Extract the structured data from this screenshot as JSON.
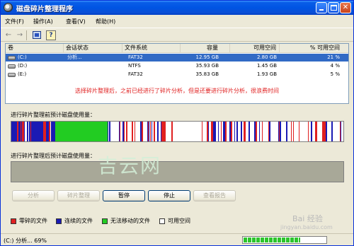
{
  "window": {
    "title": "磁盘碎片整理程序",
    "controls": {
      "minimize": "",
      "maximize": "",
      "close": "✕"
    }
  },
  "menu": [
    "文件(F)",
    "操作(A)",
    "查看(V)",
    "帮助(H)"
  ],
  "toolbar": {
    "back": "←",
    "forward": "→",
    "help": "?"
  },
  "volumes": {
    "headers": [
      "卷",
      "会话状态",
      "文件系统",
      "容量",
      "可用空间",
      "% 可用空间"
    ],
    "rows": [
      {
        "volume": "(C:)",
        "status": "分析...",
        "fs": "FAT32",
        "capacity": "12.95 GB",
        "free": "2.80 GB",
        "pct": "21 %",
        "selected": true
      },
      {
        "volume": "(D:)",
        "status": "",
        "fs": "NTFS",
        "capacity": "35.93 GB",
        "free": "1.45 GB",
        "pct": "4 %",
        "selected": false
      },
      {
        "volume": "(E:)",
        "status": "",
        "fs": "FAT32",
        "capacity": "35.83 GB",
        "free": "1.93 GB",
        "pct": "5 %",
        "selected": false
      }
    ]
  },
  "notice": "选择碎片整理后，之前已经进行了碎片分析，但是还要进行碎片分析，很浪费时间",
  "maps": {
    "before_label": "进行碎片整理前预计磁盘使用量：",
    "after_label": "进行碎片整理后预计磁盘使用量："
  },
  "buttons": {
    "analyze": "分析",
    "defrag": "碎片整理",
    "pause": "暂停",
    "stop": "停止",
    "report": "查看报告"
  },
  "legend": [
    {
      "label": "零碎的文件",
      "color": "#e02020"
    },
    {
      "label": "连续的文件",
      "color": "#1a1ab4"
    },
    {
      "label": "无法移动的文件",
      "color": "#22cc22"
    },
    {
      "label": "可用空间",
      "color": "#ffffff"
    }
  ],
  "status": {
    "text": "(C:) 分析... 69%",
    "progress_fraction": 0.69
  },
  "watermarks": {
    "center": "吉云网",
    "corner": "Bai 经验",
    "url": "jingyan.baidu.com"
  },
  "colors": {
    "fragmented": "#e02020",
    "contiguous": "#1a1ab4",
    "unmovable": "#22cc22",
    "free": "#ffffff",
    "selection": "#316ac5"
  }
}
